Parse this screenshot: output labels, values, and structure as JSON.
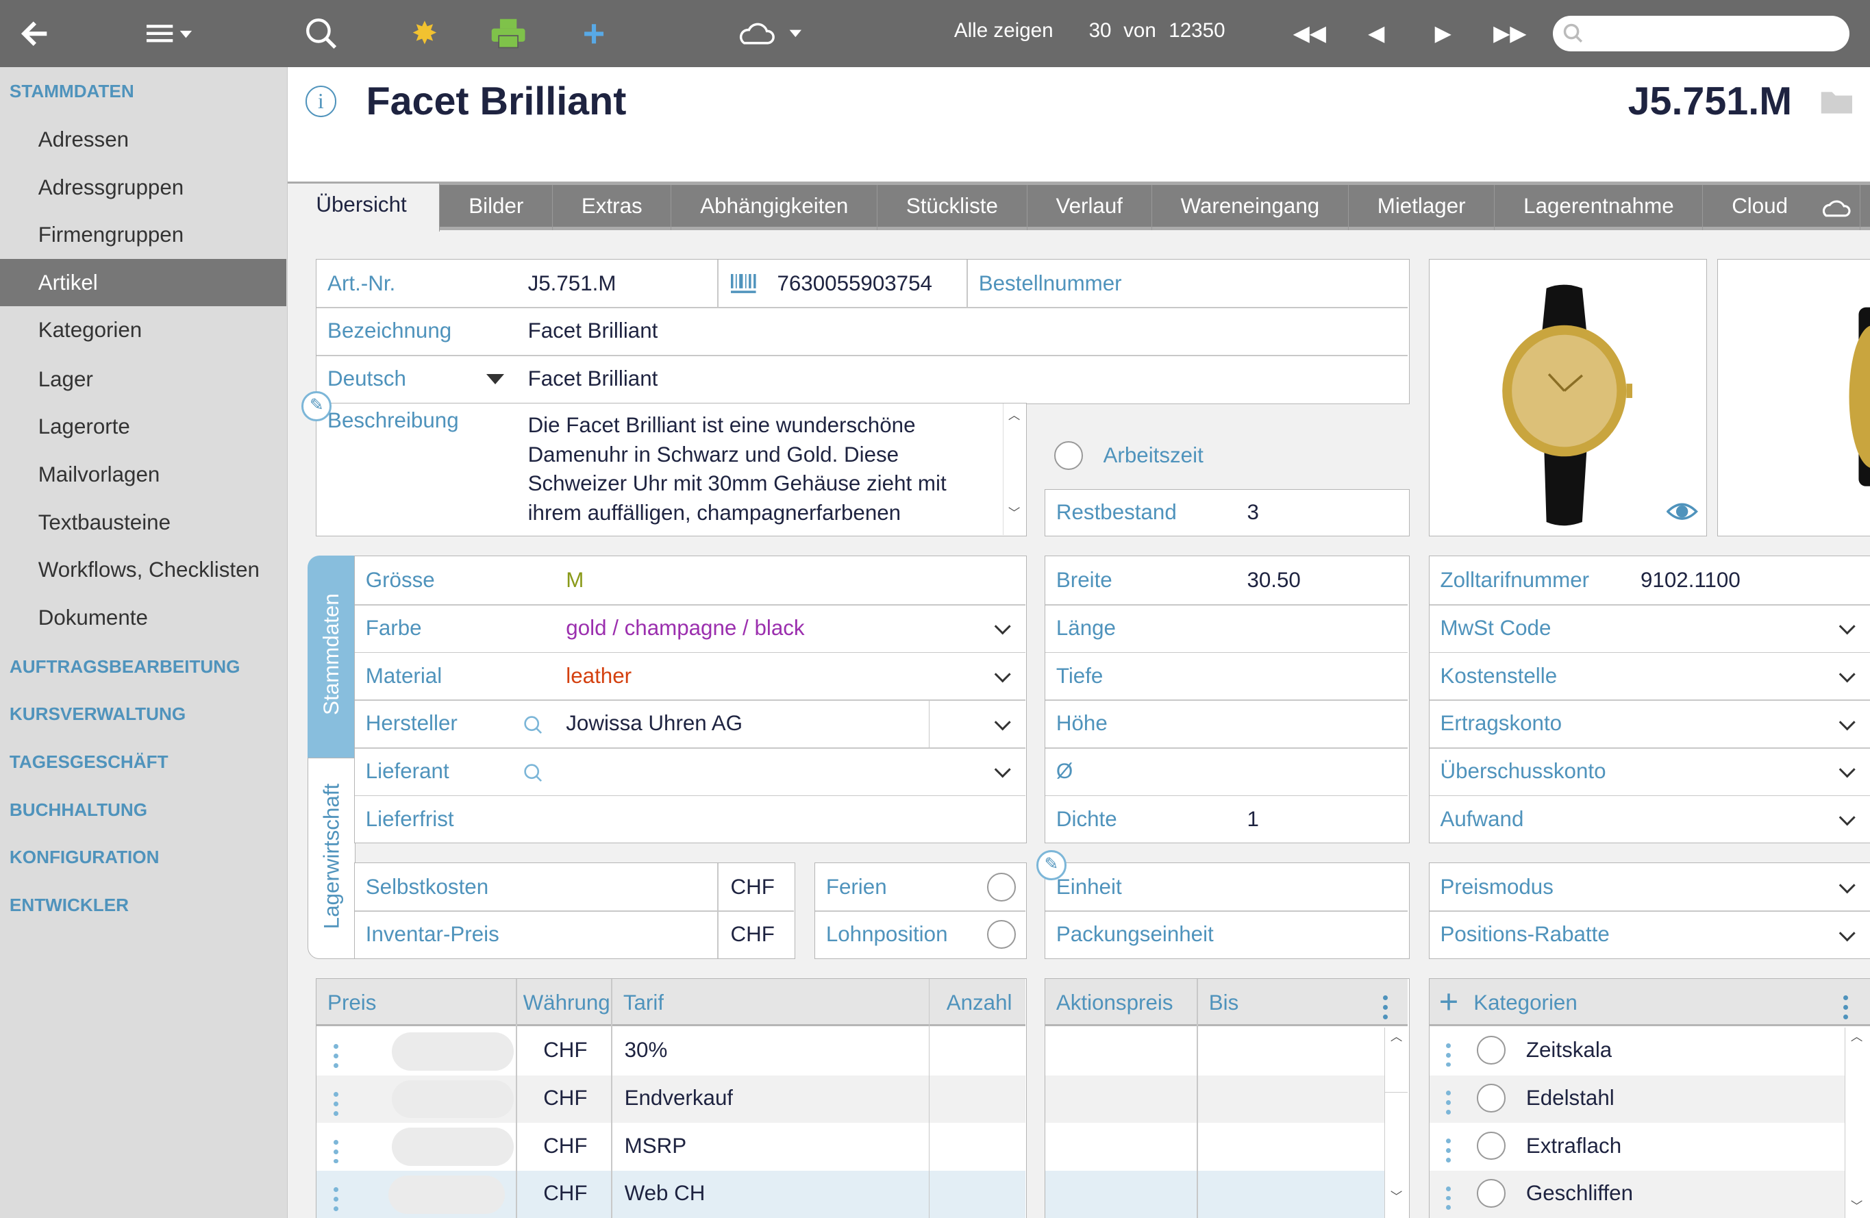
{
  "toolbar": {
    "show_all": "Alle zeigen",
    "count": "30",
    "of": "von",
    "total": "12350",
    "search_placeholder": "",
    "icons": [
      "back-arrow-icon",
      "list-menu-icon",
      "search-icon",
      "gear-icon",
      "printer-icon",
      "plus-icon",
      "cloud-icon",
      "first-icon",
      "prev-icon",
      "next-icon",
      "last-icon"
    ]
  },
  "sidebar": {
    "sections": [
      {
        "label": "STAMMDATEN",
        "items": [
          "Adressen",
          "Adressgruppen",
          "Firmengruppen",
          "Artikel",
          "Kategorien",
          "Lager",
          "Lagerorte",
          "Mailvorlagen",
          "Textbausteine",
          "Workflows, Checklisten",
          "Dokumente"
        ],
        "selected": "Artikel"
      },
      {
        "label": "AUFTRAGSBEARBEITUNG"
      },
      {
        "label": "KURSVERWALTUNG"
      },
      {
        "label": "TAGESGESCHÄFT"
      },
      {
        "label": "BUCHHALTUNG"
      },
      {
        "label": "KONFIGURATION"
      },
      {
        "label": "ENTWICKLER"
      }
    ]
  },
  "header": {
    "title": "Facet Brilliant",
    "code": "J5.751.M"
  },
  "tabs": [
    "Übersicht",
    "Bilder",
    "Extras",
    "Abhängigkeiten",
    "Stückliste",
    "Verlauf",
    "Wareneingang",
    "Mietlager",
    "Lagerentnahme",
    "Cloud"
  ],
  "form": {
    "art_nr_label": "Art.-Nr.",
    "art_nr": "J5.751.M",
    "ean": "7630055903754",
    "bestellnummer_label": "Bestellnummer",
    "bezeichnung_label": "Bezeichnung",
    "bezeichnung": "Facet Brilliant",
    "language": "Deutsch",
    "bezeichnung_lang": "Facet Brilliant",
    "beschreibung_label": "Beschreibung",
    "beschreibung_lines": [
      "Die Facet Brilliant ist eine wunderschöne",
      "Damenuhr in Schwarz und Gold. Diese",
      "Schweizer Uhr mit 30mm Gehäuse zieht mit",
      "ihrem auffälligen, champagnerfarbenen"
    ],
    "arbeitszeit_label": "Arbeitszeit",
    "restbestand_label": "Restbestand",
    "restbestand": "3",
    "vtab_stammdaten": "Stammdaten",
    "vtab_lager": "Lagerwirtschaft",
    "groesse_label": "Grösse",
    "groesse": "M",
    "farbe_label": "Farbe",
    "farbe": "gold / champagne / black",
    "material_label": "Material",
    "material": "leather",
    "hersteller_label": "Hersteller",
    "hersteller": "Jowissa Uhren AG",
    "lieferant_label": "Lieferant",
    "lieferfrist_label": "Lieferfrist",
    "selbstkosten_label": "Selbstkosten",
    "inventar_label": "Inventar-Preis",
    "currency": "CHF",
    "ferien_label": "Ferien",
    "lohnposition_label": "Lohnposition",
    "breite_label": "Breite",
    "breite": "30.50",
    "laenge_label": "Länge",
    "tiefe_label": "Tiefe",
    "hoehe_label": "Höhe",
    "durchmesser_label": "Ø",
    "dichte_label": "Dichte",
    "dichte": "1",
    "einheit_label": "Einheit",
    "packungseinheit_label": "Packungseinheit",
    "zoll_label": "Zolltarifnummer",
    "zoll": "9102.1100",
    "mwst_label": "MwSt Code",
    "kostenstelle_label": "Kostenstelle",
    "ertragskonto_label": "Ertragskonto",
    "ueberschuss_label": "Überschusskonto",
    "aufwand_label": "Aufwand",
    "preismodus_label": "Preismodus",
    "rabatte_label": "Positions-Rabatte"
  },
  "colors": {
    "farbe": "#9b2fae",
    "material": "#d4400f",
    "groesse": "#8a9a1a",
    "label": "#4f93bc"
  },
  "prices": {
    "headers": [
      "Preis",
      "Währung",
      "Tarif",
      "Anzahl"
    ],
    "rows": [
      {
        "currency": "CHF",
        "tarif": "30%"
      },
      {
        "currency": "CHF",
        "tarif": "Endverkauf"
      },
      {
        "currency": "CHF",
        "tarif": "MSRP"
      },
      {
        "currency": "CHF",
        "tarif": "Web CH"
      }
    ]
  },
  "aktion": {
    "headers": [
      "Aktionspreis",
      "Bis"
    ]
  },
  "kategorien": {
    "header": "Kategorien",
    "items": [
      "Zeitskala",
      "Edelstahl",
      "Extraflach",
      "Geschliffen"
    ]
  }
}
